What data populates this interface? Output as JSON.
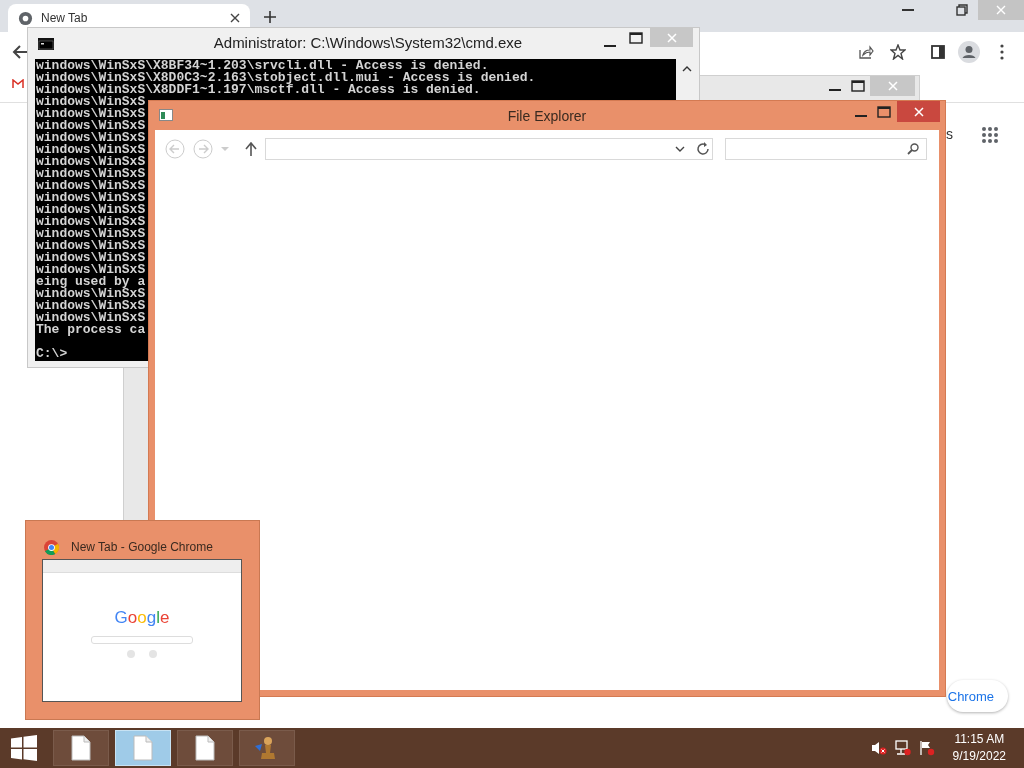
{
  "browser": {
    "tab": {
      "title": "New Tab",
      "selected": true
    },
    "partial_link": "s",
    "customize_button": "Chrome"
  },
  "console_window": {
    "title": "Administrator: C:\\Windows\\System32\\cmd.exe",
    "lines": [
      "windows\\WinSxS\\X8BF34~1.203\\srvcli.dll - Access is denied.",
      "windows\\WinSxS\\X8D0C3~2.163\\stobject.dll.mui - Access is denied.",
      "windows\\WinSxS\\X8DDF1~1.197\\msctf.dll - Access is denied.",
      "windows\\WinSxS",
      "windows\\WinSxS",
      "windows\\WinSxS",
      "windows\\WinSxS",
      "windows\\WinSxS",
      "windows\\WinSxS",
      "windows\\WinSxS",
      "windows\\WinSxS",
      "windows\\WinSxS",
      "windows\\WinSxS",
      "windows\\WinSxS",
      "windows\\WinSxS",
      "windows\\WinSxS",
      "windows\\WinSxS",
      "windows\\WinSxS",
      "eing used by a",
      "windows\\WinSxS",
      "windows\\WinSxS",
      "windows\\WinSxS",
      "The process ca"
    ],
    "prompt": "C:\\>"
  },
  "explorer_window": {
    "title": "File Explorer"
  },
  "taskbar_preview": {
    "title": "New Tab - Google Chrome",
    "logo": "Google"
  },
  "taskbar": {
    "buttons": [
      {
        "kind": "document",
        "selected": false
      },
      {
        "kind": "document",
        "selected": true
      },
      {
        "kind": "document",
        "selected": false
      },
      {
        "kind": "pawn",
        "selected": false
      }
    ],
    "clock": {
      "time": "11:15 AM",
      "date": "9/19/2022"
    }
  }
}
